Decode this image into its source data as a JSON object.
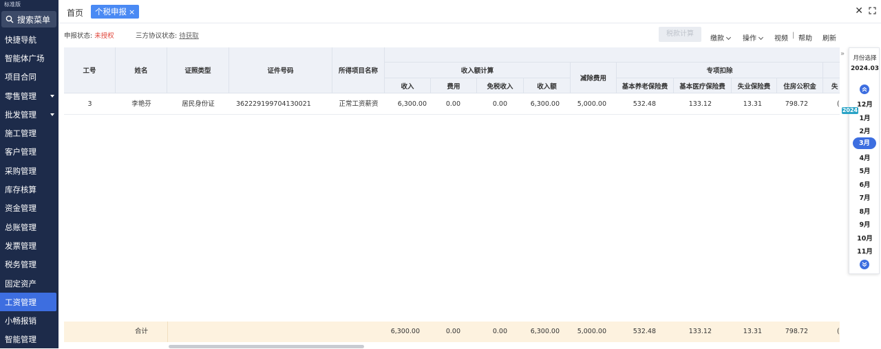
{
  "sidebar": {
    "edition": "标准版",
    "search_label": "搜索菜单",
    "items": [
      {
        "label": "快捷导航",
        "has_sub": false
      },
      {
        "label": "智能体广场",
        "has_sub": false
      },
      {
        "label": "项目合同",
        "has_sub": false
      },
      {
        "label": "零售管理",
        "has_sub": true
      },
      {
        "label": "批发管理",
        "has_sub": true
      },
      {
        "label": "施工管理",
        "has_sub": false
      },
      {
        "label": "客户管理",
        "has_sub": false
      },
      {
        "label": "采购管理",
        "has_sub": false
      },
      {
        "label": "库存核算",
        "has_sub": false
      },
      {
        "label": "资金管理",
        "has_sub": false
      },
      {
        "label": "总账管理",
        "has_sub": false
      },
      {
        "label": "发票管理",
        "has_sub": false
      },
      {
        "label": "税务管理",
        "has_sub": false
      },
      {
        "label": "固定资产",
        "has_sub": false
      },
      {
        "label": "工资管理",
        "has_sub": false,
        "active": true
      },
      {
        "label": "小畅报销",
        "has_sub": false
      },
      {
        "label": "智能管理",
        "has_sub": false
      }
    ]
  },
  "tabs": {
    "home": "首页",
    "active": "个税申报",
    "close_glyph": "×"
  },
  "window": {
    "close_glyph": "✕"
  },
  "toolbar": {
    "declare_status_label": "申报状态:",
    "declare_status_value": "未授权",
    "agreement_status_label": "三方协议状态:",
    "agreement_status_value": "待获取",
    "calc_button": "税款计算",
    "pay": "缴款",
    "operate": "操作",
    "video": "视频",
    "divider": "|",
    "help": "帮助",
    "refresh": "刷新"
  },
  "table": {
    "headers": {
      "emp_no": "工号",
      "name": "姓名",
      "id_type": "证照类型",
      "id_no": "证件号码",
      "income_item": "所得项目名称",
      "income_calc": "收入额计算",
      "income": "收入",
      "expense": "费用",
      "tax_free": "免税收入",
      "income_amount": "收入额",
      "deduction": "减除费用",
      "special_deduction": "专项扣除",
      "pension": "基本养老保险费",
      "medical": "基本医疗保险费",
      "unemployment": "失业保险费",
      "housing_fund": "住房公积金"
    },
    "rows": [
      {
        "emp_no": "3",
        "name": "李艳芬",
        "id_type": "居民身份证",
        "id_no": "362229199704130021",
        "income_item": "正常工资薪资",
        "income": "6,300.00",
        "expense": "0.00",
        "tax_free": "0.00",
        "income_amount": "6,300.00",
        "deduction": "5,000.00",
        "pension": "532.48",
        "medical": "133.12",
        "unemployment": "13.31",
        "housing_fund": "798.72",
        "cut_value": "("
      }
    ],
    "footer": {
      "label": "合计",
      "income": "6,300.00",
      "expense": "0.00",
      "tax_free": "0.00",
      "income_amount": "6,300.00",
      "deduction": "5,000.00",
      "pension": "532.48",
      "medical": "133.12",
      "unemployment": "13.31",
      "housing_fund": "798.72",
      "cut_value": "("
    },
    "cut_header": "失"
  },
  "month_picker": {
    "collapse_glyph": "»",
    "title": "月份选择",
    "current": "2024.03",
    "year_badge": "2024",
    "months": [
      "12月",
      "1月",
      "2月",
      "3月",
      "4月",
      "5月",
      "6月",
      "7月",
      "8月",
      "9月",
      "10月",
      "11月"
    ],
    "selected_month": "3月"
  },
  "colors": {
    "sidebar_bg": "#1d2b4a",
    "accent": "#3d6ee0",
    "status_red": "#e0453a",
    "footer_bg": "#fdf2df",
    "header_bg": "#eef1f7"
  }
}
